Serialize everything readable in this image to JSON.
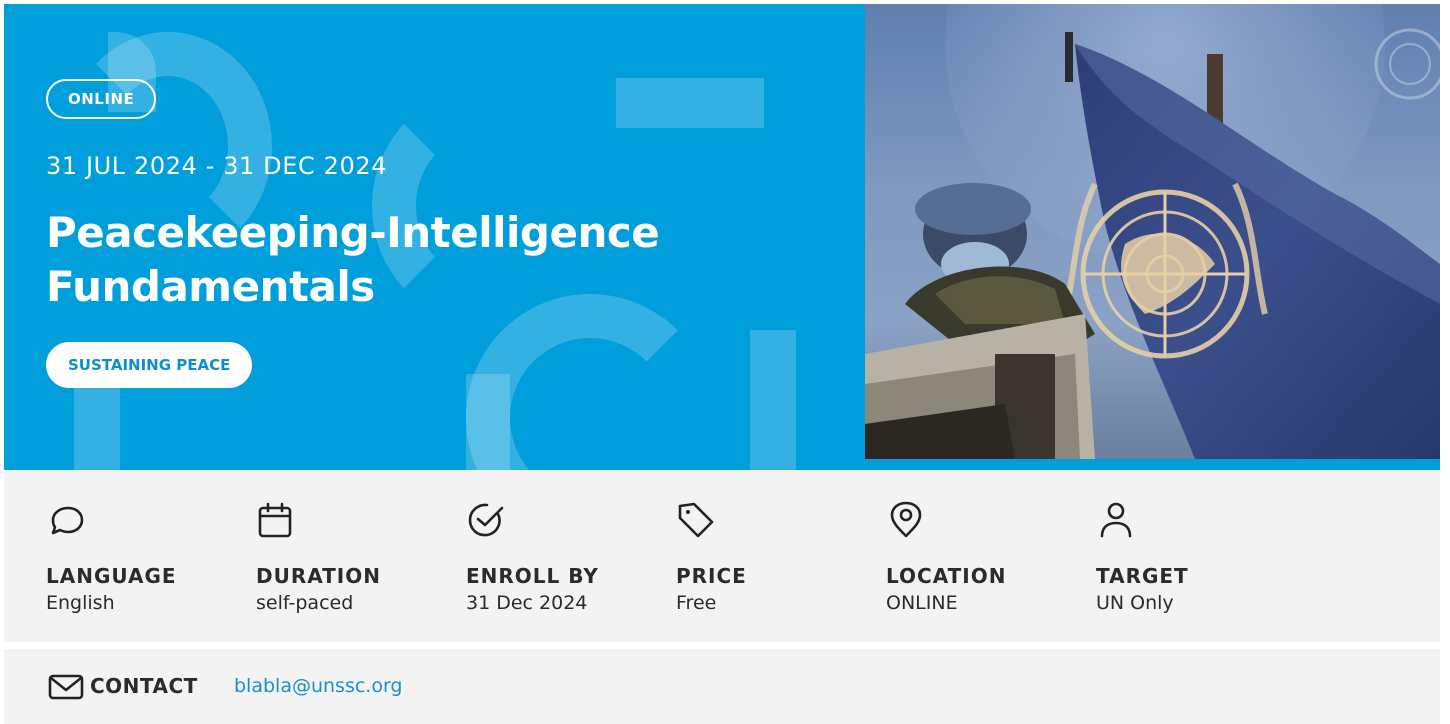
{
  "hero": {
    "delivery_badge": "ONLINE",
    "dates": "31 JUL 2024 - 31 DEC 2024",
    "title_line1": "Peacekeeping-Intelligence",
    "title_line2": "Fundamentals",
    "theme_badge": "SUSTAINING PEACE",
    "background_color": "#009edb"
  },
  "photo": {
    "icon": "un-flag-peacekeeper-photo"
  },
  "info": {
    "items": [
      {
        "icon": "chat-bubble-icon",
        "label": "LANGUAGE",
        "value": "English"
      },
      {
        "icon": "calendar-icon",
        "label": "DURATION",
        "value": "self-paced"
      },
      {
        "icon": "check-circle-icon",
        "label": "ENROLL BY",
        "value": "31 Dec 2024"
      },
      {
        "icon": "tag-icon",
        "label": "PRICE",
        "value": "Free"
      },
      {
        "icon": "location-pin-icon",
        "label": "LOCATION",
        "value": "ONLINE"
      },
      {
        "icon": "user-icon",
        "label": "TARGET",
        "value": "UN Only"
      }
    ]
  },
  "contact": {
    "icon": "mail-icon",
    "label": "CONTACT",
    "email": "blabla@unssc.org",
    "link_color": "#1a8fd0"
  }
}
